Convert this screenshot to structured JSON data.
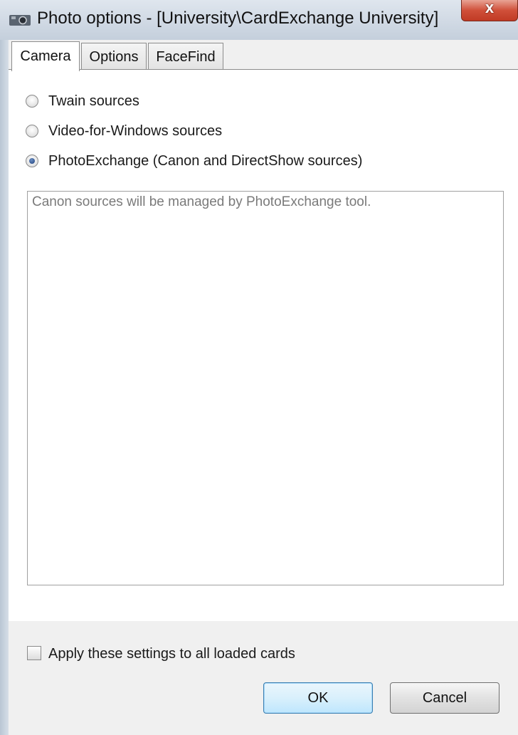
{
  "window": {
    "title": "Photo options - [University\\CardExchange University]",
    "close_symbol": "x"
  },
  "tabs": [
    {
      "label": "Camera",
      "active": true
    },
    {
      "label": "Options",
      "active": false
    },
    {
      "label": "FaceFind",
      "active": false
    }
  ],
  "sources": {
    "options": [
      {
        "label": "Twain sources",
        "checked": false
      },
      {
        "label": "Video-for-Windows sources",
        "checked": false
      },
      {
        "label": "PhotoExchange (Canon and DirectShow sources)",
        "checked": true
      }
    ],
    "info_text": "Canon sources will be managed by PhotoExchange tool."
  },
  "apply_all": {
    "label": "Apply these settings to all loaded cards",
    "checked": false
  },
  "buttons": {
    "ok": "OK",
    "cancel": "Cancel"
  },
  "colors": {
    "default_button_border": "#3c7fb1",
    "close_button": "#c8472f"
  }
}
